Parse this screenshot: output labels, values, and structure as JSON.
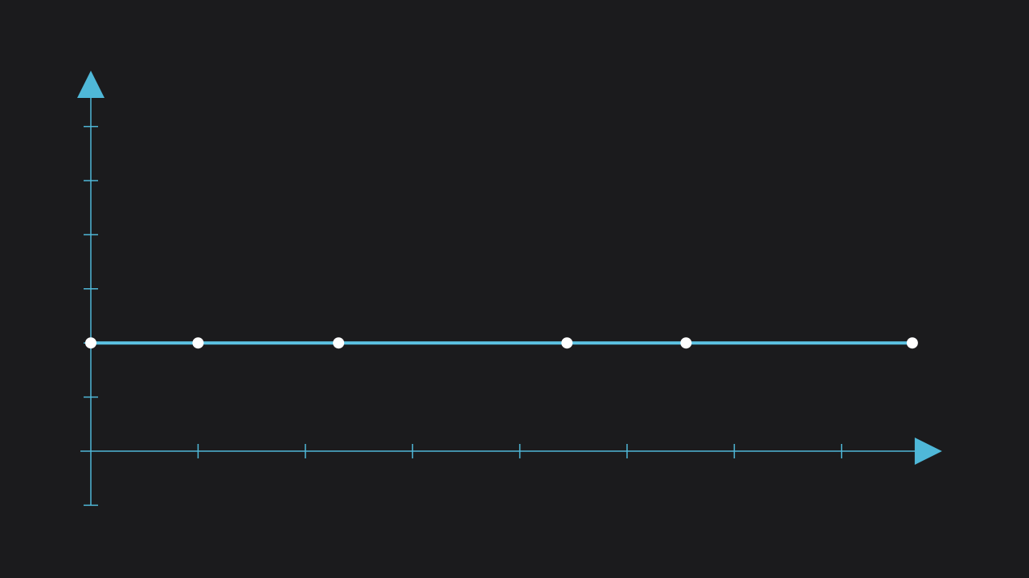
{
  "chart_data": {
    "type": "line",
    "title": "",
    "xlabel": "",
    "ylabel": "",
    "xlim": [
      0,
      7.6
    ],
    "ylim": [
      -1,
      7
    ],
    "x_ticks": [
      1,
      2,
      3,
      4,
      5,
      6,
      7
    ],
    "y_ticks": [
      -1,
      1,
      2,
      3,
      4,
      5,
      6
    ],
    "grid": false,
    "series": [
      {
        "x": [
          0,
          1,
          2.31,
          4.44,
          5.55,
          7.66
        ],
        "y": [
          2,
          2,
          2,
          2,
          2,
          2
        ]
      }
    ],
    "colors": {
      "background": "#1b1b1d",
      "axis": "#4fb8d8",
      "line": "#5cc3e3",
      "point_fill": "#ffffff"
    }
  }
}
